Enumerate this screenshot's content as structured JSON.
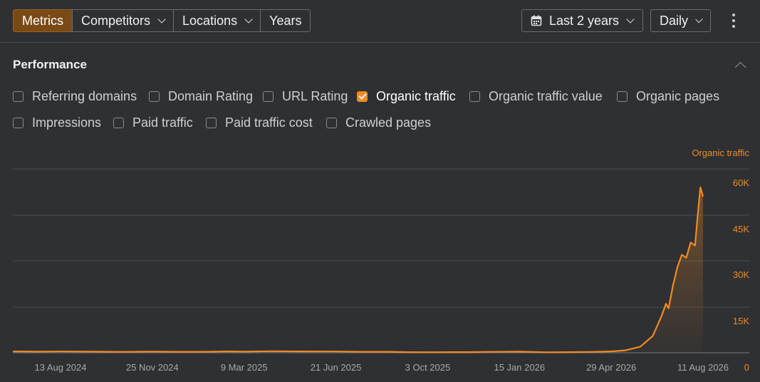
{
  "toolbar": {
    "tabs": [
      {
        "label": "Metrics",
        "active": true,
        "dropdown": false
      },
      {
        "label": "Competitors",
        "active": false,
        "dropdown": true
      },
      {
        "label": "Locations",
        "active": false,
        "dropdown": true
      },
      {
        "label": "Years",
        "active": false,
        "dropdown": false
      }
    ],
    "date_range": "Last 2 years",
    "granularity": "Daily",
    "more_icon": "vertical-dots-icon"
  },
  "performance": {
    "title": "Performance",
    "metrics_row1": [
      {
        "label": "Referring domains",
        "checked": false
      },
      {
        "label": "Domain Rating",
        "checked": false
      },
      {
        "label": "URL Rating",
        "checked": false
      },
      {
        "label": "Organic traffic",
        "checked": true
      },
      {
        "label": "Organic traffic value",
        "checked": false
      },
      {
        "label": "Organic pages",
        "checked": false
      }
    ],
    "metrics_row2": [
      {
        "label": "Impressions",
        "checked": false
      },
      {
        "label": "Paid traffic",
        "checked": false
      },
      {
        "label": "Paid traffic cost",
        "checked": false
      },
      {
        "label": "Crawled pages",
        "checked": false
      }
    ]
  },
  "colors": {
    "accent": "#f08a24",
    "background": "#2f3033",
    "grid": "#4a4b4f"
  },
  "chart_data": {
    "type": "line",
    "series": [
      {
        "name": "Organic traffic",
        "color": "#f08a24",
        "points": [
          [
            "2024-06-20",
            450
          ],
          [
            "2024-07-20",
            380
          ],
          [
            "2024-08-13",
            420
          ],
          [
            "2024-09-15",
            370
          ],
          [
            "2024-10-20",
            310
          ],
          [
            "2024-11-25",
            380
          ],
          [
            "2024-12-20",
            330
          ],
          [
            "2025-01-20",
            320
          ],
          [
            "2025-02-20",
            450
          ],
          [
            "2025-03-09",
            370
          ],
          [
            "2025-04-10",
            520
          ],
          [
            "2025-05-10",
            450
          ],
          [
            "2025-06-21",
            420
          ],
          [
            "2025-07-20",
            330
          ],
          [
            "2025-08-20",
            320
          ],
          [
            "2025-09-10",
            200
          ],
          [
            "2025-10-03",
            180
          ],
          [
            "2025-11-15",
            220
          ],
          [
            "2025-12-15",
            300
          ],
          [
            "2026-01-15",
            380
          ],
          [
            "2026-02-15",
            170
          ],
          [
            "2026-03-10",
            220
          ],
          [
            "2026-04-05",
            280
          ],
          [
            "2026-04-29",
            450
          ],
          [
            "2026-05-15",
            800
          ],
          [
            "2026-06-01",
            2000
          ],
          [
            "2026-06-15",
            5500
          ],
          [
            "2026-06-25",
            12000
          ],
          [
            "2026-06-30",
            16000
          ],
          [
            "2026-07-03",
            14500
          ],
          [
            "2026-07-08",
            22000
          ],
          [
            "2026-07-13",
            28000
          ],
          [
            "2026-07-18",
            32000
          ],
          [
            "2026-07-23",
            31000
          ],
          [
            "2026-07-28",
            36000
          ],
          [
            "2026-08-02",
            35000
          ],
          [
            "2026-08-05",
            45000
          ],
          [
            "2026-08-08",
            54000
          ],
          [
            "2026-08-11",
            51000
          ]
        ]
      }
    ],
    "x_ticks": [
      "13 Aug 2024",
      "25 Nov 2024",
      "9 Mar 2025",
      "21 Jun 2025",
      "3 Oct 2025",
      "15 Jan 2026",
      "29 Apr 2026",
      "11 Aug 2026"
    ],
    "y_ticks": [
      "0",
      "15K",
      "30K",
      "45K",
      "60K"
    ],
    "ylim": [
      0,
      60000
    ],
    "ylabel": "Organic traffic",
    "grid": true
  }
}
